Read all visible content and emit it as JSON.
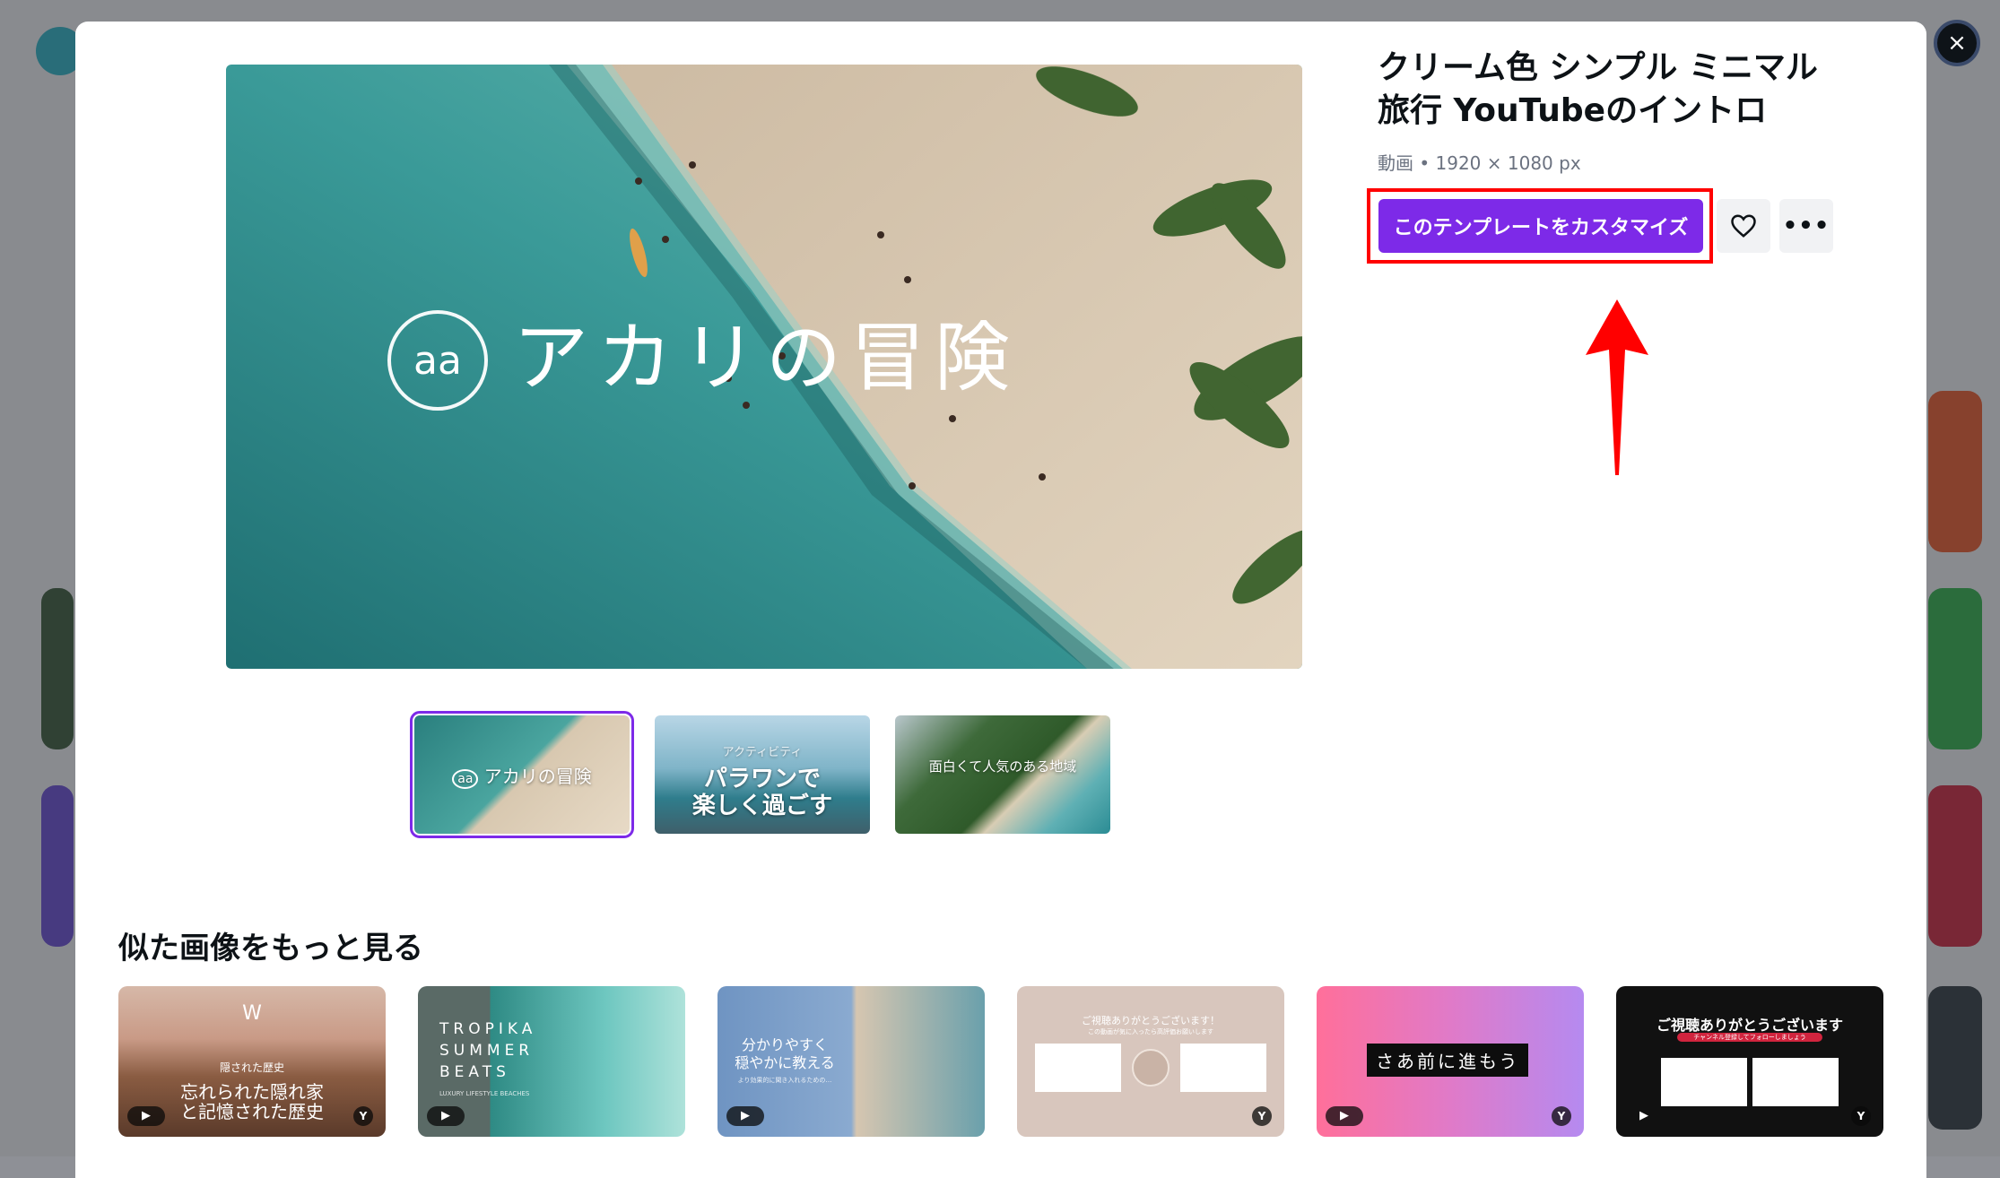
{
  "close_icon": "×",
  "template": {
    "title": "クリーム色 シンプル ミニマル 旅行 YouTubeのイントロ",
    "meta": "動画 • 1920 × 1080 px",
    "customize_label": "このテンプレートをカスタマイズ",
    "more_label": "•••",
    "accent_color": "#7d2ae8",
    "annotation_color": "#ff0000"
  },
  "preview": {
    "logo_text": "aa",
    "overlay_text": "アカリの冒険"
  },
  "thumbnails": [
    {
      "logo": "aa",
      "text": "アカリの冒険"
    },
    {
      "small": "アクティビティ",
      "line1": "パラワンで",
      "line2": "楽しく過ごす"
    },
    {
      "text": "面白くて人気のある地域"
    }
  ],
  "similar": {
    "heading": "似た画像をもっと見る",
    "play_icon": "▶",
    "yt_badge": "Y",
    "cards": [
      {
        "logo": "W",
        "small": "隠された歴史",
        "line1": "忘れられた隠れ家",
        "line2": "と記憶された歴史"
      },
      {
        "line1": "TROPIKA",
        "line2": "SUMMER",
        "line3": "BEATS",
        "small": "LUXURY LIFESTYLE BEACHES"
      },
      {
        "line1": "分かりやすく",
        "line2": "穏やかに教える",
        "small": "より効果的に聞き入れるための…"
      },
      {
        "line1": "ご視聴ありがとうございます！",
        "small": "この動画が気に入ったら高評価お願いします"
      },
      {
        "line1": "さあ前に進もう"
      },
      {
        "line1": "ご視聴ありがとうございます",
        "small": "チャンネル登録してフォローしましょう"
      }
    ]
  }
}
